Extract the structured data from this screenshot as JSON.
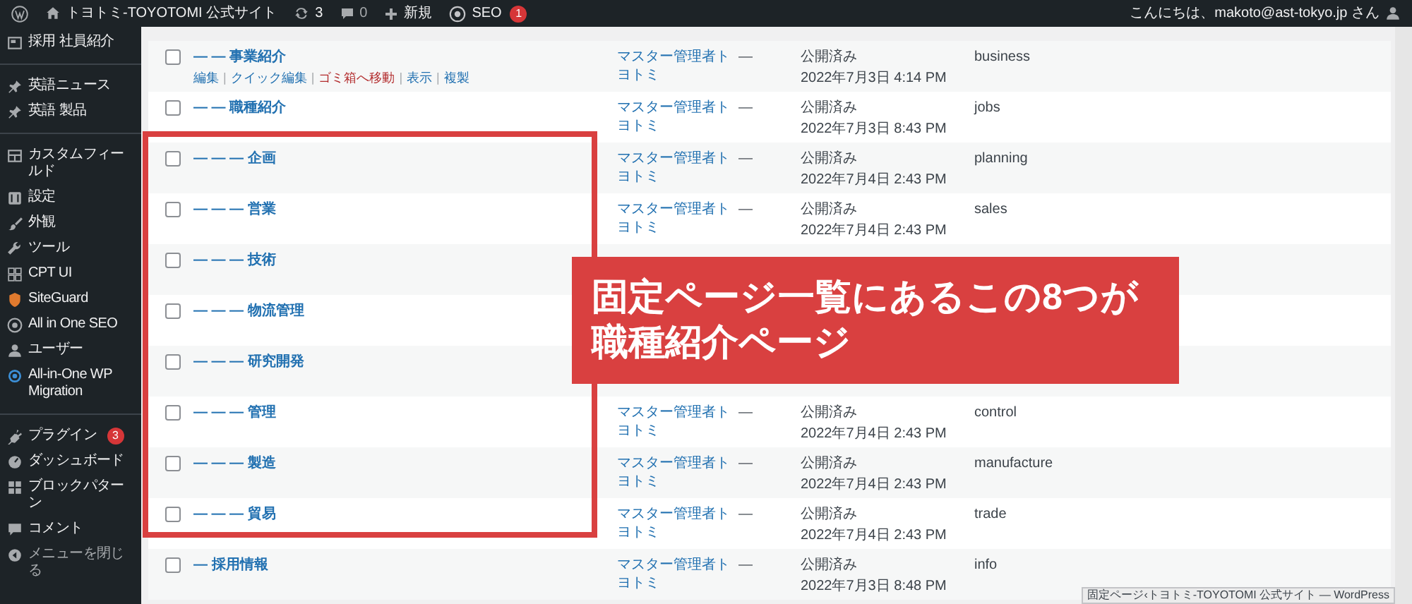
{
  "admin_bar": {
    "site_title": "トヨトミ-TOYOTOMI 公式サイト",
    "updates": "3",
    "comments": "0",
    "new_label": "新規",
    "seo_label": "SEO",
    "seo_badge": "1",
    "greeting": "こんにちは、makoto@ast-tokyo.jp さん"
  },
  "sidebar": {
    "groups": [
      [
        {
          "label": "採用 社員紹介",
          "dimmed": false
        }
      ],
      [
        {
          "label": "英語ニュース",
          "dimmed": false
        },
        {
          "label": "英語 製品",
          "dimmed": false
        }
      ],
      [
        {
          "label": "カスタムフィールド",
          "dimmed": false
        },
        {
          "label": "設定",
          "dimmed": false
        },
        {
          "label": "外観",
          "dimmed": false
        },
        {
          "label": "ツール",
          "dimmed": false
        },
        {
          "label": "CPT UI",
          "dimmed": false
        },
        {
          "label": "SiteGuard",
          "dimmed": false
        },
        {
          "label": "All in One SEO",
          "dimmed": false
        },
        {
          "label": "ユーザー",
          "dimmed": false
        },
        {
          "label": "All-in-One WP Migration",
          "dimmed": false
        }
      ],
      [
        {
          "label": "プラグイン",
          "badge": "3",
          "dimmed": false
        },
        {
          "label": "ダッシュボード",
          "dimmed": false
        },
        {
          "label": "ブロックパターン",
          "dimmed": false
        },
        {
          "label": "コメント",
          "dimmed": false
        },
        {
          "label": "メニューを閉じる",
          "dimmed": true
        }
      ]
    ]
  },
  "table": {
    "rows": [
      {
        "title": "— — 事業紹介",
        "checked": false,
        "row_actions": [
          {
            "label": "編集",
            "kind": "normal"
          },
          {
            "label": "クイック編集",
            "kind": "normal"
          },
          {
            "label": "ゴミ箱へ移動",
            "kind": "delete"
          },
          {
            "label": "表示",
            "kind": "normal"
          },
          {
            "label": "複製",
            "kind": "normal"
          }
        ],
        "action_separator": "|",
        "author": "マスター管理者トヨトミ",
        "comments": "—",
        "status": "公開済み",
        "date": "2022年7月3日 4:14 PM",
        "slug": "business"
      },
      {
        "title": "— — 職種紹介",
        "checked": false,
        "author": "マスター管理者トヨトミ",
        "comments": "—",
        "status": "公開済み",
        "date": "2022年7月3日 8:43 PM",
        "slug": "jobs"
      },
      {
        "title": "— — — 企画",
        "checked": false,
        "author": "マスター管理者トヨトミ",
        "comments": "—",
        "status": "公開済み",
        "date": "2022年7月4日 2:43 PM",
        "slug": "planning"
      },
      {
        "title": "— — — 営業",
        "checked": false,
        "author": "マスター管理者トヨトミ",
        "comments": "—",
        "status": "公開済み",
        "date": "2022年7月4日 2:43 PM",
        "slug": "sales"
      },
      {
        "title": "— — — 技術",
        "checked": false
      },
      {
        "title": "— — — 物流管理",
        "checked": false
      },
      {
        "title": "— — — 研究開発",
        "checked": false
      },
      {
        "title": "— — — 管理",
        "checked": false,
        "author": "マスター管理者トヨトミ",
        "comments": "—",
        "status": "公開済み",
        "date": "2022年7月4日 2:43 PM",
        "slug": "control"
      },
      {
        "title": "— — — 製造",
        "checked": false,
        "author": "マスター管理者トヨトミ",
        "comments": "—",
        "status": "公開済み",
        "date": "2022年7月4日 2:43 PM",
        "slug": "manufacture"
      },
      {
        "title": "— — — 貿易",
        "checked": false,
        "author": "マスター管理者トヨトミ",
        "comments": "—",
        "status": "公開済み",
        "date": "2022年7月4日 2:43 PM",
        "slug": "trade"
      },
      {
        "title": "— 採用情報",
        "checked": false,
        "author": "マスター管理者トヨトミ",
        "comments": "—",
        "status": "公開済み",
        "date": "2022年7月3日 8:48 PM",
        "slug": "info"
      }
    ]
  },
  "annotation": {
    "callout": "固定ページ一覧にあるこの8つが職種紹介ページ"
  },
  "status_tooltip": "固定ページ‹トヨトミ-TOYOTOMI 公式サイト — WordPress"
}
